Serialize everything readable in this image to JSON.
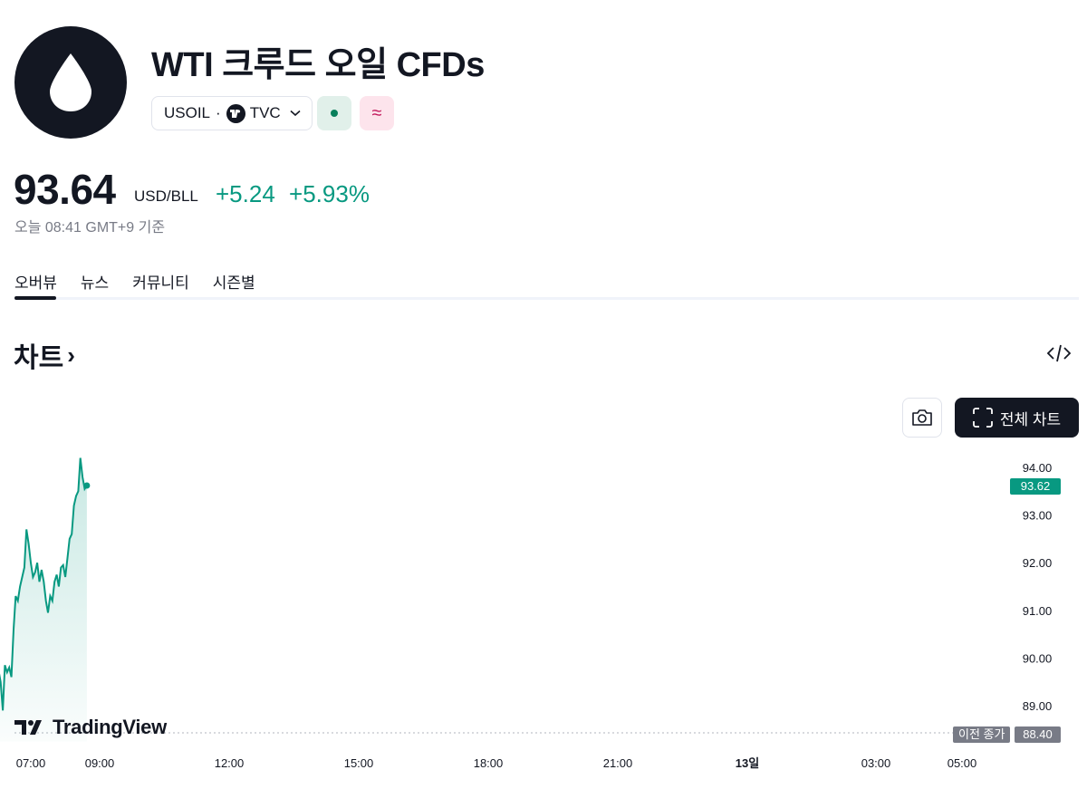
{
  "header": {
    "title": "WTI 크루드 오일 CFDs",
    "logo_icon": "oil-drop-icon",
    "symbol": "USOIL",
    "separator": "·",
    "exchange": "TVC",
    "market_status_icon": "market-open-icon",
    "approx_icon": "≈"
  },
  "quote": {
    "price": "93.64",
    "currency": "USD/BLL",
    "change_abs": "+5.24",
    "change_pct": "+5.93%",
    "timestamp": "오늘 08:41 GMT+9 기준",
    "up_color": "#089981"
  },
  "tabs": [
    {
      "label": "오버뷰",
      "active": true
    },
    {
      "label": "뉴스",
      "active": false
    },
    {
      "label": "커뮤니티",
      "active": false
    },
    {
      "label": "시즌별",
      "active": false
    }
  ],
  "chart_section": {
    "title": "차트",
    "arrow": "›",
    "full_chart_label": "전체 차트",
    "brand": "TradingView",
    "prev_close_label": "이전 종가",
    "prev_close_value": "88.40",
    "last_price_value": "93.62"
  },
  "chart_data": {
    "type": "area",
    "line_color": "#089981",
    "y_ticks": [
      "94.00",
      "93.00",
      "92.00",
      "91.00",
      "90.00",
      "89.00"
    ],
    "ylim": [
      88.4,
      94.4
    ],
    "x_ticks": [
      {
        "label": "07:00",
        "hour": 7,
        "bold": false
      },
      {
        "label": "09:00",
        "hour": 9,
        "bold": false
      },
      {
        "label": "12:00",
        "hour": 12,
        "bold": false
      },
      {
        "label": "15:00",
        "hour": 15,
        "bold": false
      },
      {
        "label": "18:00",
        "hour": 18,
        "bold": false
      },
      {
        "label": "21:00",
        "hour": 21,
        "bold": false
      },
      {
        "label": "13일",
        "hour": 24,
        "bold": true
      },
      {
        "label": "03:00",
        "hour": 27,
        "bold": false
      },
      {
        "label": "05:00",
        "hour": 29,
        "bold": false
      }
    ],
    "series": [
      {
        "values": [
          [
            6.05,
            89.7
          ],
          [
            6.1,
            89.8
          ],
          [
            6.15,
            89.6
          ],
          [
            6.2,
            89.9
          ],
          [
            6.25,
            89.75
          ],
          [
            6.3,
            89.5
          ],
          [
            6.35,
            88.9
          ],
          [
            6.4,
            89.85
          ],
          [
            6.45,
            89.7
          ],
          [
            6.5,
            89.8
          ],
          [
            6.55,
            89.6
          ],
          [
            6.6,
            90.6
          ],
          [
            6.65,
            91.3
          ],
          [
            6.7,
            91.2
          ],
          [
            6.75,
            91.5
          ],
          [
            6.8,
            91.7
          ],
          [
            6.85,
            91.9
          ],
          [
            6.9,
            92.7
          ],
          [
            6.95,
            92.4
          ],
          [
            7.0,
            92.0
          ],
          [
            7.05,
            91.7
          ],
          [
            7.1,
            91.8
          ],
          [
            7.15,
            92.0
          ],
          [
            7.2,
            91.6
          ],
          [
            7.25,
            91.85
          ],
          [
            7.3,
            91.6
          ],
          [
            7.35,
            91.2
          ],
          [
            7.4,
            90.95
          ],
          [
            7.45,
            91.3
          ],
          [
            7.5,
            91.2
          ],
          [
            7.55,
            91.6
          ],
          [
            7.6,
            91.75
          ],
          [
            7.65,
            91.5
          ],
          [
            7.7,
            91.9
          ],
          [
            7.75,
            91.95
          ],
          [
            7.8,
            91.7
          ],
          [
            7.85,
            92.1
          ],
          [
            7.9,
            92.5
          ],
          [
            7.95,
            92.6
          ],
          [
            8.0,
            93.2
          ],
          [
            8.05,
            93.4
          ],
          [
            8.1,
            93.5
          ],
          [
            8.15,
            94.2
          ],
          [
            8.2,
            93.8
          ],
          [
            8.25,
            93.55
          ],
          [
            8.3,
            93.62
          ]
        ]
      }
    ]
  }
}
